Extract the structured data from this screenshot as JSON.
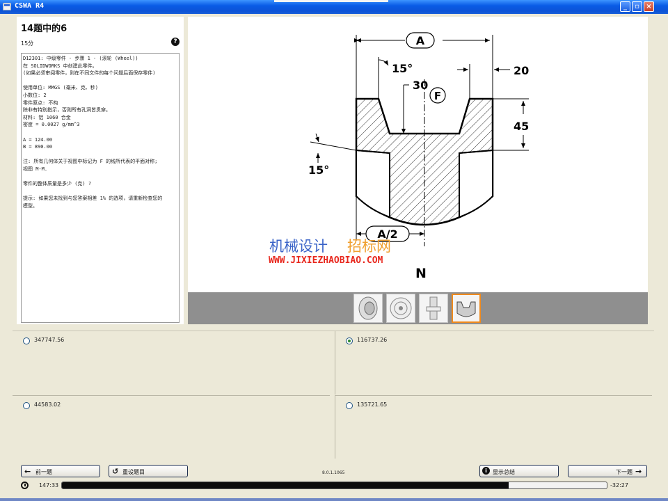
{
  "window": {
    "title": "CSWA R4"
  },
  "question": {
    "header": "14题中的6",
    "points": "15分",
    "text_lines": [
      "D12301: 中级零件 - 步骤 1 - (滚轮 (Wheel))",
      "在 SOLIDWORKS 中创建此零件。",
      "(如果必须审阅零件，则在不同文件的每个问题后面保存零件)",
      "",
      "使用单位: MMGS (毫米、克、秒)",
      "小数位: 2",
      "零件原点: 不构",
      "除非有特别指示，否则所有孔洞皆贯穿。",
      "材料: 铝 1060 合金",
      "密度 = 0.0027 g/mm^3",
      "",
      "A = 124.00",
      "B = 890.00",
      "",
      "注: 所有几何体关于视图中标记为 F 的线所代表的平面对称;",
      "视图 M-M.",
      "",
      "零件的整体质量是多少 (克) ?",
      "",
      "提示: 如果您未找到与您答案相差 1% 的选项，请重新检查您的",
      "模型。"
    ]
  },
  "drawing": {
    "dim_A": "A",
    "dim_half_A": "A/2",
    "dim_15_top": "15°",
    "dim_15_left": "15°",
    "dim_30": "30",
    "dim_20": "20",
    "dim_45": "45",
    "label_F": "F",
    "view_label": "N",
    "watermark_cn_blue": "机械设计",
    "watermark_cn_orange": "招标网",
    "watermark_url": "WWW.JIXIEZHAOBIAO.COM",
    "colors": {
      "watermark_blue": "#3b64c8",
      "watermark_orange": "#f0a030",
      "watermark_url": "#e8281e",
      "thumb_selected": "#f08a1c"
    }
  },
  "thumbnails": [
    {
      "icon": "wheel-iso-view",
      "selected": false
    },
    {
      "icon": "wheel-front-view",
      "selected": false
    },
    {
      "icon": "wheel-side-view",
      "selected": false
    },
    {
      "icon": "wheel-section-view",
      "selected": true
    }
  ],
  "answers": [
    {
      "value": "347747.56",
      "selected": false
    },
    {
      "value": "116737.26",
      "selected": true
    },
    {
      "value": "44583.02",
      "selected": false
    },
    {
      "value": "135721.65",
      "selected": false
    }
  ],
  "footer": {
    "prev_label": "前一题",
    "reset_label": "重设题目",
    "version": "8.0.1.1065",
    "summary_label": "显示总结",
    "next_label": "下一题",
    "time_elapsed": "147:33",
    "time_remaining": "-32:27",
    "time_progress": 0.82
  }
}
